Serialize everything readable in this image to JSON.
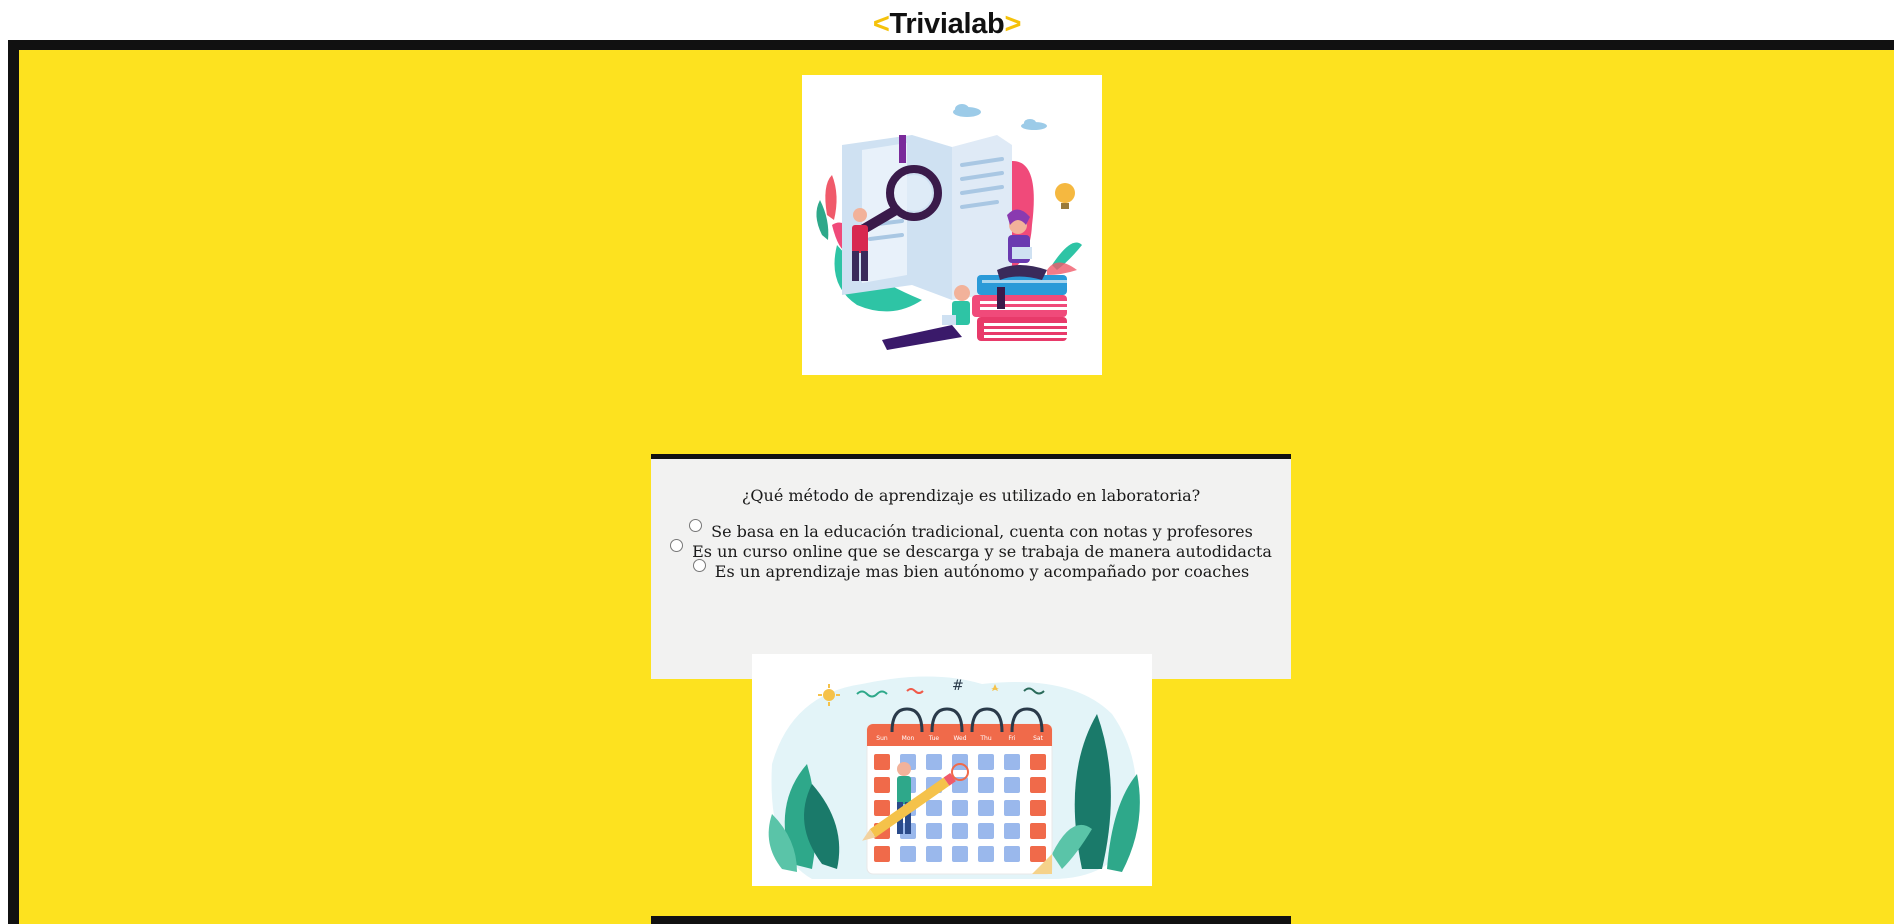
{
  "header": {
    "logo_left_bracket": "<",
    "logo_text": "Trivialab",
    "logo_right_bracket": ">"
  },
  "question": {
    "text": "¿Qué método de aprendizaje es utilizado en laboratoria?",
    "options": [
      {
        "label": "Se basa en la educación tradicional, cuenta con notas y profesores"
      },
      {
        "label": "Es un curso online que se descarga y se trabaja de manera autodidacta"
      },
      {
        "label": "Es un aprendizaje mas bien autónomo y acompañado por coaches"
      }
    ]
  },
  "calendar_illustration": {
    "days": [
      "Sun",
      "Mon",
      "Tue",
      "Wed",
      "Thu",
      "Fri",
      "Sat"
    ]
  },
  "colors": {
    "background_yellow": "#fde21f",
    "frame_black": "#111111",
    "card_gray": "#f2f2f1",
    "logo_accent": "#f5c20a"
  },
  "icons": {
    "study_illustration": "books-magnifier-illustration",
    "calendar_illustration": "calendar-pencil-illustration"
  }
}
